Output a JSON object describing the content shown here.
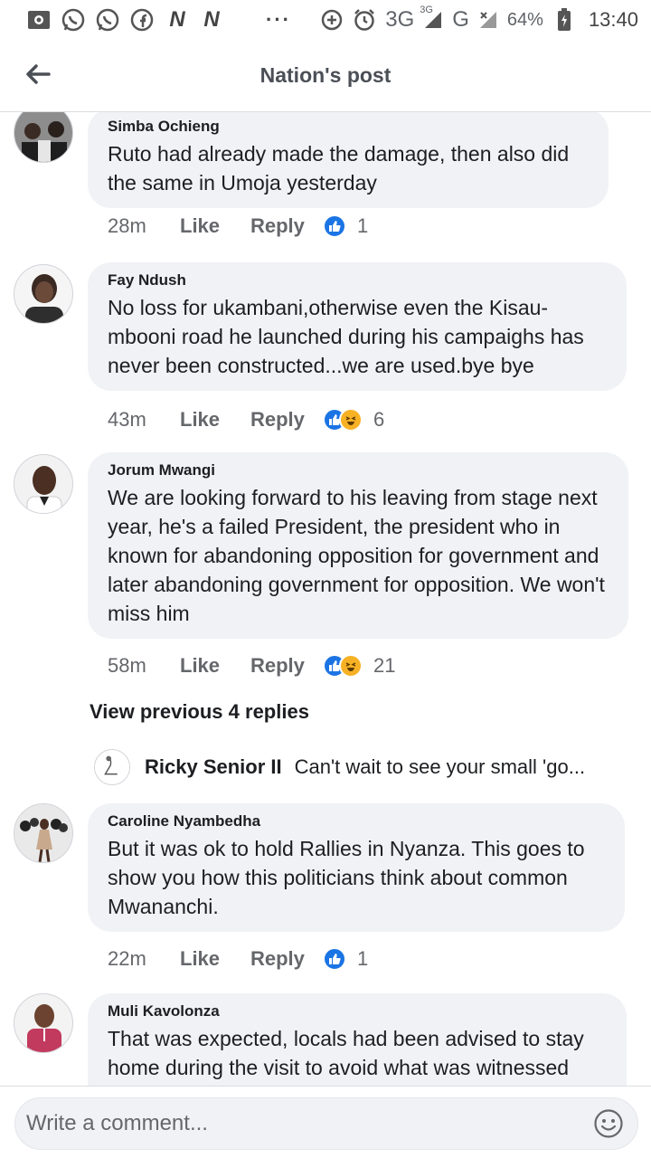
{
  "status_bar": {
    "dots": "···",
    "network_3g": "3G",
    "network_3g_small": "3G",
    "network_g": "G",
    "battery": "64%",
    "time": "13:40",
    "icons": [
      "photo-icon",
      "whatsapp-icon",
      "whatsapp-icon",
      "facebook-icon",
      "n-app-icon",
      "n-app-icon",
      "add-circle-icon",
      "alarm-icon",
      "signal-icon",
      "battery-icon"
    ]
  },
  "header": {
    "title": "Nation's post"
  },
  "comments": [
    {
      "author": "Simba Ochieng",
      "text": "Ruto had already made the damage, then also did the same in Umoja yesterday",
      "time": "28m",
      "like_label": "Like",
      "reply_label": "Reply",
      "reactions": [
        "like"
      ],
      "reaction_count": "1"
    },
    {
      "author": "Fay Ndush",
      "text": "No loss for ukambani,otherwise even the Kisau-mbooni road he launched during his campaighs has never been constructed...we are used.bye bye",
      "time": "43m",
      "like_label": "Like",
      "reply_label": "Reply",
      "reactions": [
        "like",
        "haha"
      ],
      "reaction_count": "6"
    },
    {
      "author": "Jorum Mwangi",
      "text": "We are looking forward to his leaving from stage next year, he's a failed President,  the president who in known for abandoning opposition for government and later abandoning government for opposition. We won't miss him",
      "time": "58m",
      "like_label": "Like",
      "reply_label": "Reply",
      "reactions": [
        "like",
        "haha"
      ],
      "reaction_count": "21"
    },
    {
      "author": "Caroline Nyambedha",
      "text": "But it was ok to hold Rallies in Nyanza. This goes to show you how this politicians think about common Mwananchi.",
      "time": "22m",
      "like_label": "Like",
      "reply_label": "Reply",
      "reactions": [
        "like"
      ],
      "reaction_count": "1"
    },
    {
      "author": "Muli Kavolonza",
      "text": "That was expected, locals had been advised to stay home during the visit to avoid what was witnessed"
    }
  ],
  "replies": {
    "view_previous": "View previous 4 replies",
    "latest": {
      "author": "Ricky Senior II",
      "text": "Can't wait to see your small 'go..."
    }
  },
  "composer": {
    "placeholder": "Write a comment..."
  },
  "colors": {
    "accent": "#1b74e4",
    "haha": "#f7b125",
    "bubble": "#f0f2f5"
  }
}
